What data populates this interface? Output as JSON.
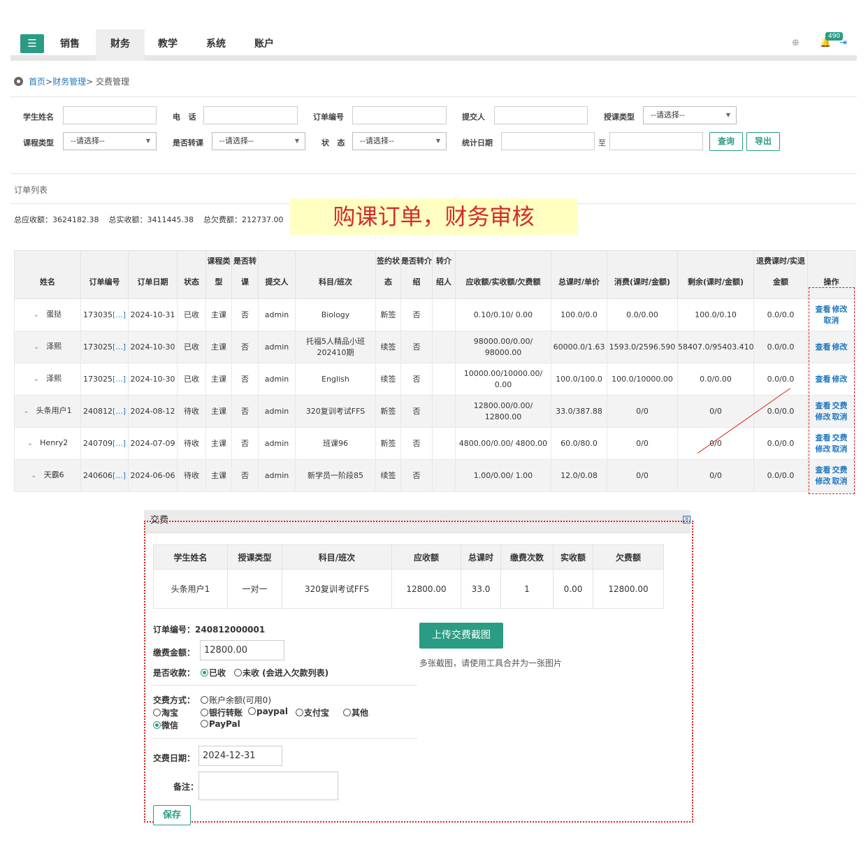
{
  "nav": {
    "menu_icon": "hamburger-icon",
    "items": [
      {
        "label": "销售"
      },
      {
        "label": "财务"
      },
      {
        "label": "教学"
      },
      {
        "label": "系统"
      },
      {
        "label": "账户"
      }
    ],
    "active": "财务",
    "badge_count": "490",
    "accent_color": "#2a9c83"
  },
  "breadcrumb": {
    "home": "首页",
    "sep1": ">",
    "section": "财务管理",
    "sep2": ">",
    "current": "交费管理"
  },
  "filters": {
    "student_name_label": "学生姓名",
    "phone_label": "电   话",
    "order_no_label": "订单编号",
    "submitter_label": "提交人",
    "teach_type_label": "授课类型",
    "teach_type_value": "--请选择--",
    "course_type_label": "课程类型",
    "course_type_value": "--请选择--",
    "transfer_label": "是否转课",
    "transfer_value": "--请选择--",
    "status_label": "状   态",
    "status_value": "--请选择--",
    "date_label": "统计日期",
    "date_to": "至",
    "query_button": "查询",
    "export_button": "导出"
  },
  "list_title": "订单列表",
  "totals": {
    "receivable_label": "总应收额：",
    "receivable": "3624182.38",
    "received_label": "总实收额：",
    "received": "3411445.38",
    "owed_label": "总欠费额：",
    "owed": "212737.00"
  },
  "banner": "购课订单，财务审核",
  "table": {
    "headers": [
      "姓名",
      "订单编号",
      "订单日期",
      "状态",
      "课程类型",
      "是否转课",
      "提交人",
      "科目/班次",
      "签约状态",
      "是否转介绍",
      "转介绍人",
      "应收额/实收额/欠费额",
      "总课时/单价",
      "消费(课时/金额)",
      "剩余(课时/金额)",
      "退费课时/实退金额",
      "操作"
    ],
    "rows": [
      {
        "name": "蛋挞",
        "order_no": "173035",
        "more": "[...]",
        "date": "2024-10-31",
        "status": "已收",
        "course_type": "主课",
        "transfer": "否",
        "submitter": "admin",
        "subject": "Biology",
        "sign": "新签",
        "referral": "否",
        "referrer": "",
        "amounts": "0.10/0.10/ 0.00",
        "hours_price": "100.0/0.0",
        "consumed": "0.0/0.00",
        "remaining": "100.0/0.10",
        "refund": "0.0/0.0",
        "ops": [
          "查看",
          "修改",
          "取消"
        ]
      },
      {
        "name": "泽熙",
        "order_no": "173025",
        "more": "[...]",
        "date": "2024-10-30",
        "status": "已收",
        "course_type": "主课",
        "transfer": "否",
        "submitter": "admin",
        "subject": "托福5人精品小班202410期",
        "sign": "续签",
        "referral": "否",
        "referrer": "",
        "amounts": "98000.00/0.00/ 98000.00",
        "hours_price": "60000.0/1.63",
        "consumed": "1593.0/2596.590",
        "remaining": "58407.0/95403.410",
        "refund": "0.0/0.0",
        "ops": [
          "查看",
          "修改"
        ]
      },
      {
        "name": "泽熙",
        "order_no": "173025",
        "more": "[...]",
        "date": "2024-10-30",
        "status": "已收",
        "course_type": "主课",
        "transfer": "否",
        "submitter": "admin",
        "subject": "English",
        "sign": "续签",
        "referral": "否",
        "referrer": "",
        "amounts": "10000.00/10000.00/ 0.00",
        "hours_price": "100.0/100.0",
        "consumed": "100.0/10000.00",
        "remaining": "0.0/0.00",
        "refund": "0.0/0.0",
        "ops": [
          "查看",
          "修改"
        ]
      },
      {
        "name": "头条用户1",
        "order_no": "240812",
        "more": "[...]",
        "date": "2024-08-12",
        "status": "待收",
        "course_type": "主课",
        "transfer": "否",
        "submitter": "admin",
        "subject": "320复训考试FFS",
        "sign": "新签",
        "referral": "否",
        "referrer": "",
        "amounts": "12800.00/0.00/ 12800.00",
        "hours_price": "33.0/387.88",
        "consumed": "0/0",
        "remaining": "0/0",
        "refund": "0.0/0.0",
        "ops": [
          "查看",
          "交费",
          "修改",
          "取消"
        ]
      },
      {
        "name": "Henry2",
        "order_no": "240709",
        "more": "[...]",
        "date": "2024-07-09",
        "status": "待收",
        "course_type": "主课",
        "transfer": "否",
        "submitter": "admin",
        "subject": "班课96",
        "sign": "新签",
        "referral": "否",
        "referrer": "",
        "amounts": "4800.00/0.00/ 4800.00",
        "hours_price": "60.0/80.0",
        "consumed": "0/0",
        "remaining": "0/0",
        "refund": "0.0/0.0",
        "ops": [
          "查看",
          "交费",
          "修改",
          "取消"
        ]
      },
      {
        "name": "天霸6",
        "order_no": "240606",
        "more": "[...]",
        "date": "2024-06-06",
        "status": "待收",
        "course_type": "主课",
        "transfer": "否",
        "submitter": "admin",
        "subject": "新学员一阶段85",
        "sign": "续签",
        "referral": "否",
        "referrer": "",
        "amounts": "1.00/0.00/ 1.00",
        "hours_price": "12.0/0.08",
        "consumed": "0/0",
        "remaining": "0/0",
        "refund": "0.0/0.0",
        "ops": [
          "查看",
          "交费",
          "修改",
          "取消"
        ]
      }
    ]
  },
  "dialog": {
    "title": "交费",
    "headers": [
      "学生姓名",
      "授课类型",
      "科目/班次",
      "应收额",
      "总课时",
      "缴费次数",
      "实收额",
      "欠费额"
    ],
    "row": [
      "头条用户1",
      "一对一",
      "320复训考试FFS",
      "12800.00",
      "33.0",
      "1",
      "0.00",
      "12800.00"
    ],
    "order_no_label": "订单编号：",
    "order_no": "240812000001",
    "amount_label": "缴费金额：",
    "amount": "12800.00",
    "received_label": "是否收款：",
    "received_yes": "已收",
    "received_no": "未收 (会进入欠款列表)",
    "method_label": "交费方式：",
    "methods": {
      "balance": "账户余额(可用0)",
      "taobao": "淘宝",
      "bank": "银行转账",
      "paypal_lower": "paypal",
      "alipay": "支付宝",
      "other": "其他",
      "wechat": "微信",
      "paypal": "PayPal"
    },
    "selected_method": "微信",
    "date_label": "交费日期：",
    "date": "2024-12-31",
    "note_label": "备注：",
    "upload_button": "上传交费截图",
    "upload_tip": "多张截图，请使用工具合并为一张图片",
    "save_button": "保存"
  }
}
